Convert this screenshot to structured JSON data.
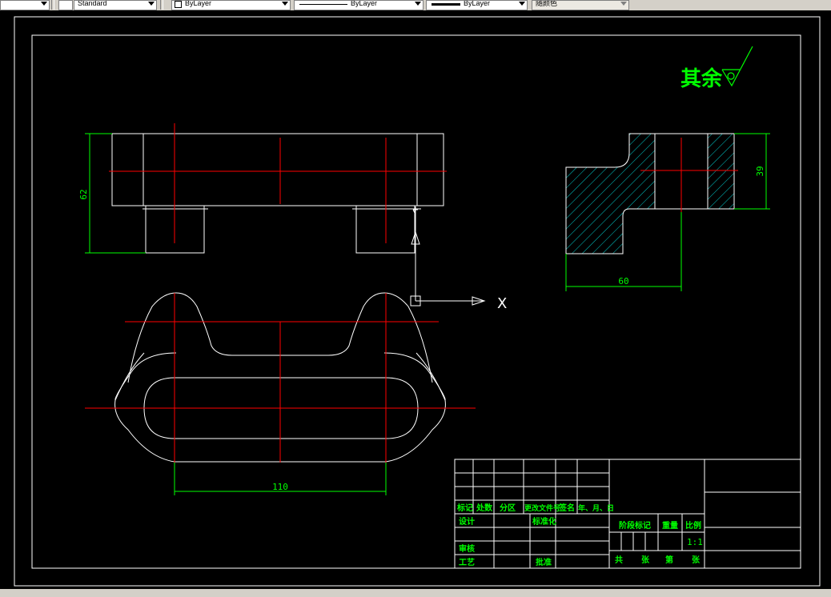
{
  "toolbar": {
    "text_style": "Standard",
    "layer_color": "ByLayer",
    "linetype": "ByLayer",
    "lineweight": "ByLayer",
    "plot_style": "随颜色"
  },
  "drawing": {
    "roughness_note": "其余",
    "dims": {
      "front_height": "62",
      "side_height": "39",
      "side_width": "60",
      "top_width": "110"
    },
    "ucs_x_label": "X",
    "title_block": {
      "c_biaoji": "标记",
      "c_chushu": "处数",
      "c_fenqu": "分区",
      "c_gengai": "更改文件号",
      "c_qianming": "签名",
      "c_date": "年、月、日",
      "c_sheji": "设计",
      "c_biaozhunhua": "标准化",
      "c_jieduan": "阶段标记",
      "c_zhongliang": "重量",
      "c_bili": "比例",
      "scale_value": "1:1",
      "c_shenhe": "审核",
      "c_gongyi": "工艺",
      "c_pizhun": "批准",
      "c_gong": "共",
      "c_zhang1": "张",
      "c_di": "第",
      "c_zhang2": "张"
    }
  },
  "colors": {
    "toolbar_bg": "#d4d0c8",
    "canvas_bg": "#000000",
    "outline": "#ffffff",
    "center_line": "#ff0000",
    "dimension": "#00ff00",
    "hatch": "#00c8c8"
  }
}
